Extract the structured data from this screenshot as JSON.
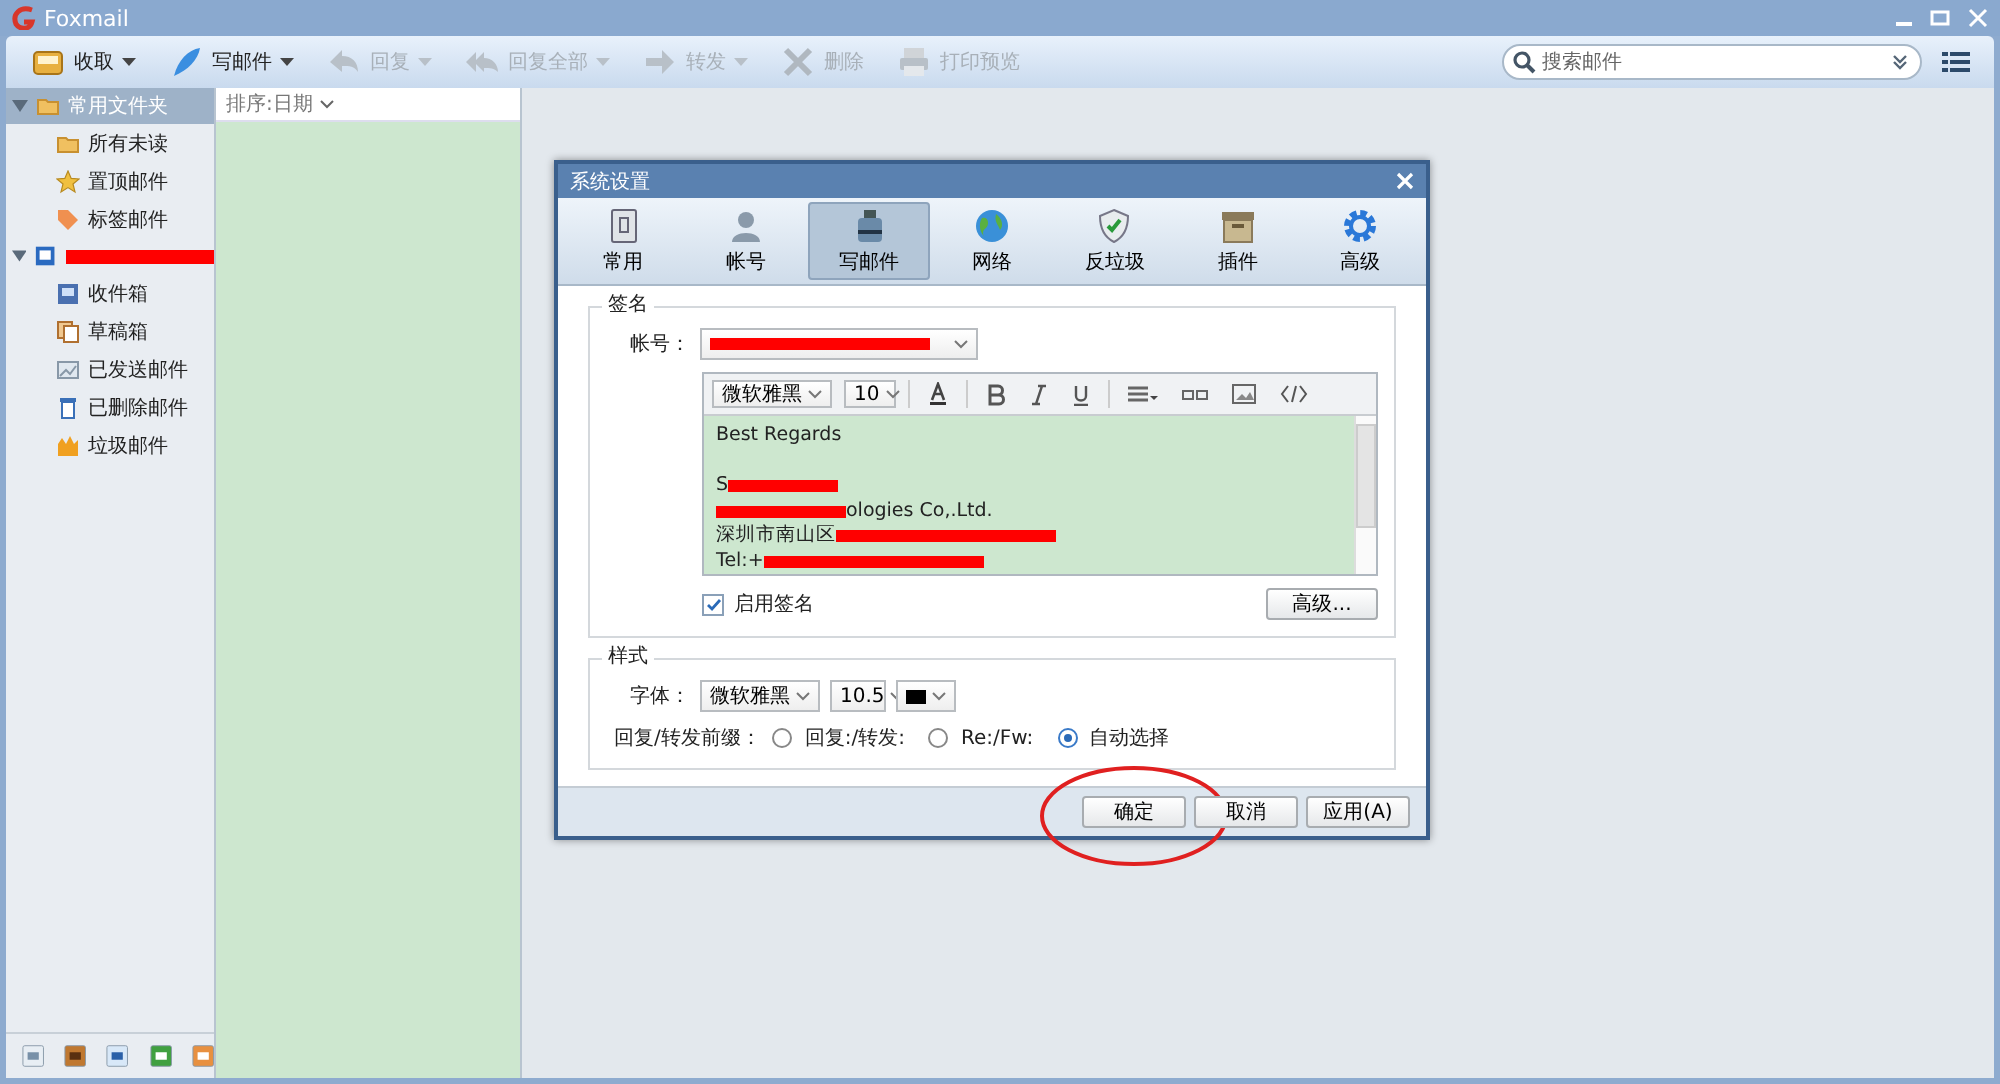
{
  "window": {
    "title": "Foxmail"
  },
  "toolbar": [
    {
      "label": "收取",
      "dropdown": true,
      "disabled": false
    },
    {
      "label": "写邮件",
      "dropdown": true,
      "disabled": false
    },
    {
      "label": "回复",
      "dropdown": true,
      "disabled": true
    },
    {
      "label": "回复全部",
      "dropdown": true,
      "disabled": true
    },
    {
      "label": "转发",
      "dropdown": true,
      "disabled": true
    },
    {
      "label": "删除",
      "dropdown": false,
      "disabled": true
    },
    {
      "label": "打印预览",
      "dropdown": false,
      "disabled": true
    }
  ],
  "search": {
    "placeholder": "搜索邮件"
  },
  "sidebar": {
    "sections": [
      {
        "label": "常用文件夹",
        "expanded": true,
        "redacted": false,
        "selected": true,
        "children": [
          {
            "label": "所有未读"
          },
          {
            "label": "置顶邮件"
          },
          {
            "label": "标签邮件"
          }
        ]
      },
      {
        "expanded": true,
        "redacted": true,
        "selected": false,
        "children": [
          {
            "label": "收件箱"
          },
          {
            "label": "草稿箱"
          },
          {
            "label": "已发送邮件"
          },
          {
            "label": "已删除邮件"
          },
          {
            "label": "垃圾邮件"
          }
        ]
      }
    ]
  },
  "message_list": {
    "sort_label": "排序:日期"
  },
  "dialog": {
    "title": "系统设置",
    "tabs": [
      {
        "label": "常用",
        "selected": false
      },
      {
        "label": "帐号",
        "selected": false
      },
      {
        "label": "写邮件",
        "selected": true
      },
      {
        "label": "网络",
        "selected": false
      },
      {
        "label": "反垃圾",
        "selected": false
      },
      {
        "label": "插件",
        "selected": false
      },
      {
        "label": "高级",
        "selected": false
      }
    ],
    "signature": {
      "title": "签名",
      "account_label": "帐号：",
      "editor_font": "微软雅黑",
      "editor_size": "10",
      "lines": [
        {
          "before": "Best Regards",
          "redacted": false
        },
        {
          "redacted": false
        },
        {
          "before": "S",
          "redacted": true
        },
        {
          "redacted": true,
          "after": "ologies Co,.Ltd."
        },
        {
          "before": "深圳市南山区",
          "redacted": true
        },
        {
          "before": "Tel:+",
          "redacted": true
        }
      ],
      "enable": {
        "label": "启用签名",
        "checked": true
      },
      "advanced_button": "高级..."
    },
    "style": {
      "title": "样式",
      "font_label": "字体：",
      "font": "微软雅黑",
      "size": "10.5",
      "color": "#000000",
      "prefix_label": "回复/转发前缀：",
      "options": [
        {
          "label": "回复:/转发:",
          "selected": false
        },
        {
          "label": "Re:/Fw:",
          "selected": false
        },
        {
          "label": "自动选择",
          "selected": true
        }
      ]
    },
    "buttons": [
      {
        "label": "确定",
        "circled": true
      },
      {
        "label": "取消",
        "circled": false
      },
      {
        "label": "应用(A)",
        "circled": false
      }
    ]
  }
}
